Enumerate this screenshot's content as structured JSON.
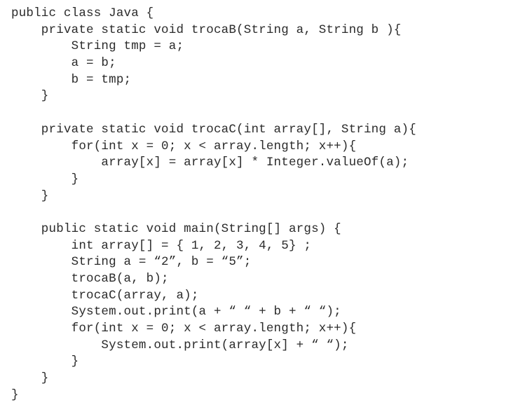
{
  "code": {
    "lines": [
      "public class Java {",
      "    private static void trocaB(String a, String b ){",
      "        String tmp = a;",
      "        a = b;",
      "        b = tmp;",
      "    }",
      "",
      "    private static void trocaC(int array[], String a){",
      "        for(int x = 0; x < array.length; x++){",
      "            array[x] = array[x] * Integer.valueOf(a);",
      "        }",
      "    }",
      "",
      "    public static void main(String[] args) {",
      "        int array[] = { 1, 2, 3, 4, 5} ;",
      "        String a = “2”, b = “5”;",
      "        trocaB(a, b);",
      "        trocaC(array, a);",
      "        System.out.print(a + “ “ + b + “ “);",
      "        for(int x = 0; x < array.length; x++){",
      "            System.out.print(array[x] + “ “);",
      "        }",
      "    }",
      "}"
    ]
  }
}
